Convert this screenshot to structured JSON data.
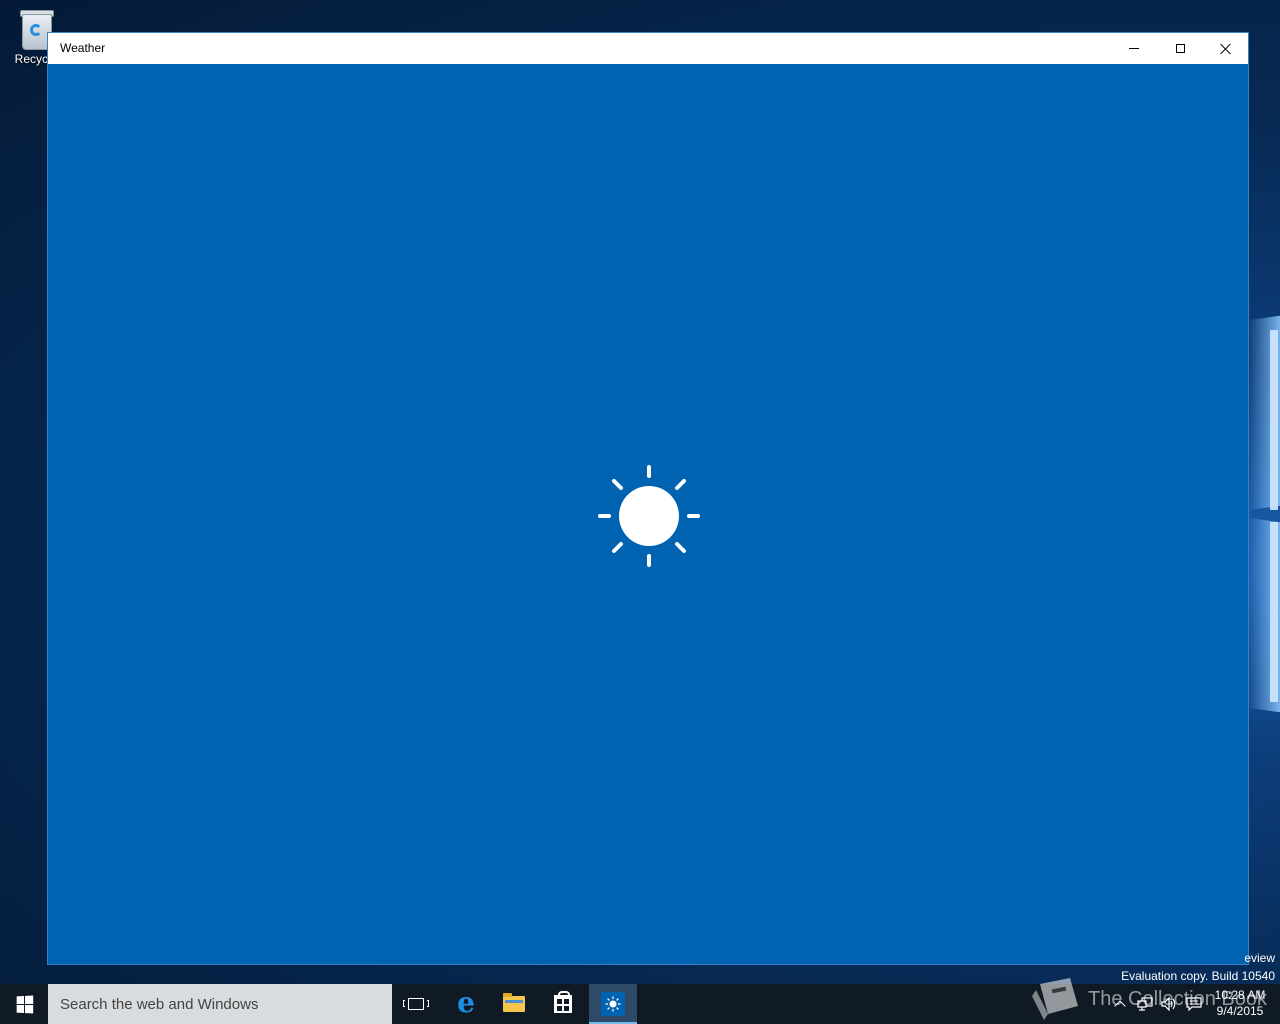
{
  "desktop": {
    "recycle_bin_label": "Recycle",
    "watermark_line1": "eview",
    "watermark_line2": "Evaluation copy. Build 10540",
    "collection_watermark": "The Collection Book"
  },
  "window": {
    "title": "Weather",
    "background_color": "#0063b1",
    "splash_icon": "sun-icon"
  },
  "taskbar": {
    "search_placeholder": "Search the web and Windows",
    "pinned": [
      "task-view-icon",
      "edge-icon",
      "file-explorer-icon",
      "store-icon",
      "weather-icon"
    ],
    "active_app": "Weather",
    "clock_time": "10:28 AM",
    "clock_date": "9/4/2015"
  },
  "colors": {
    "accent": "#0063b1",
    "taskbar": "#101a25",
    "active_indicator": "#76b9ed"
  }
}
